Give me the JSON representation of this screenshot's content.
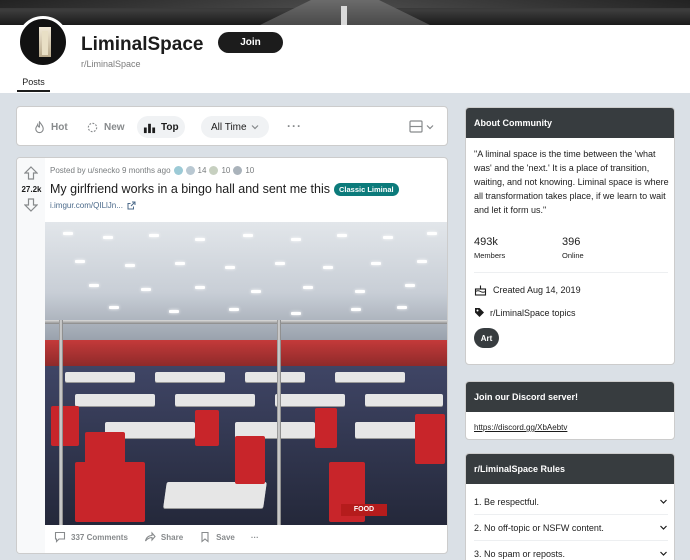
{
  "subreddit": {
    "name": "LiminalSpace",
    "handle": "r/LiminalSpace",
    "join_label": "Join",
    "tabs": [
      {
        "label": "Posts"
      }
    ]
  },
  "sort": {
    "hot": "Hot",
    "new": "New",
    "top": "Top",
    "time_filter": "All Time",
    "more": "···"
  },
  "post": {
    "votes": "27.2k",
    "meta": "Posted by u/snecko 9 months ago",
    "awards": [
      {
        "icon": "award-silver-icon",
        "count": ""
      },
      {
        "icon": "award-helpful-icon",
        "count": "14"
      },
      {
        "icon": "award-wholesome-icon",
        "count": "10"
      },
      {
        "icon": "award-rocket-icon",
        "count": "10"
      }
    ],
    "title": "My girlfriend works in a bingo hall and sent me this",
    "flair": "Classic Liminal",
    "flair_color": "#0c7b7b",
    "link": "i.imgur.com/QILlJn...",
    "comments": "337 Comments",
    "share": "Share",
    "save": "Save",
    "more": "···",
    "image_sign": "FOOD"
  },
  "about": {
    "header": "About Community",
    "description": "\"A liminal space is the time between the 'what was' and the 'next.' It is a place of transition, waiting, and not knowing. Liminal space is where all transformation takes place, if we learn to wait and let it form us.\"",
    "members_count": "493k",
    "members_label": "Members",
    "online_count": "396",
    "online_label": "Online",
    "created": "Created Aug 14, 2019",
    "topics": "r/LiminalSpace topics",
    "topic_pill": "Art"
  },
  "discord": {
    "header": "Join our Discord server!",
    "link": "https://discord.gg/XbAebtv"
  },
  "rules": {
    "header": "r/LiminalSpace Rules",
    "items": [
      {
        "label": "1. Be respectful."
      },
      {
        "label": "2. No off-topic or NSFW content."
      },
      {
        "label": "3. No spam or reposts."
      }
    ]
  },
  "colors": {
    "accent_dark": "#373c3f",
    "background": "#dae0e6",
    "join_button": "#1c1c1c"
  }
}
